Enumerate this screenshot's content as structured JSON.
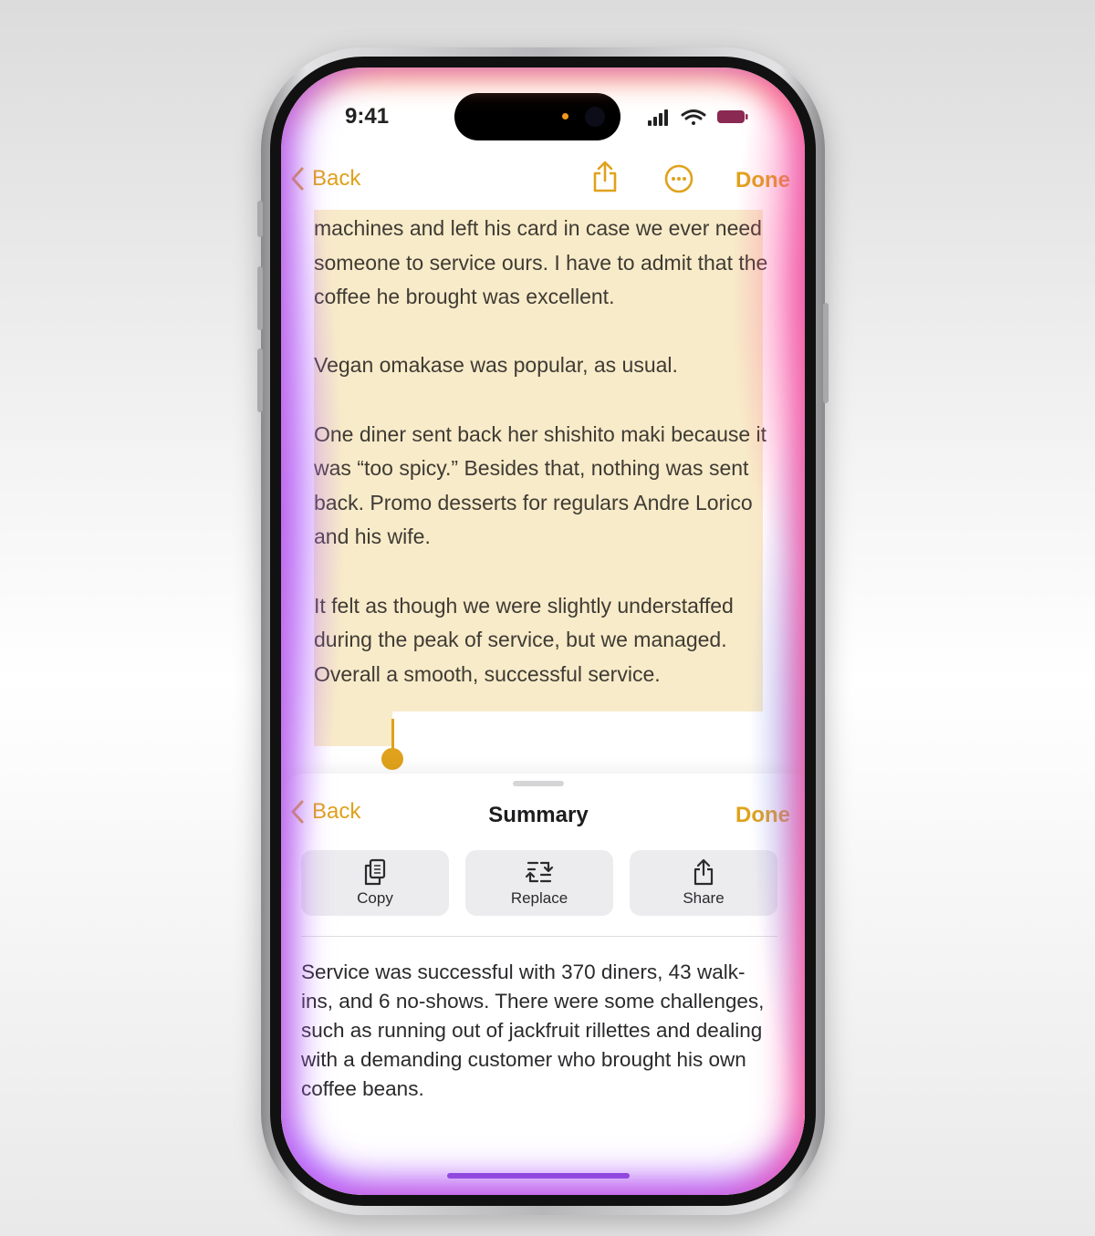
{
  "status_bar": {
    "time": "9:41"
  },
  "note_nav": {
    "back_label": "Back",
    "done_label": "Done",
    "share_icon": "share-icon",
    "more_icon": "ellipsis-circle-icon"
  },
  "note": {
    "paragraphs": [
      "machines and left his card in case we ever need someone to service ours. I have to admit that the coffee he brought was excellent.",
      "Vegan omakase was popular, as usual.",
      "One diner sent back her shishito maki because it was “too spicy.” Besides that, nothing was sent back. Promo desserts for regulars Andre Lorico and his wife.",
      "It felt as though we were slightly understaffed during the peak of service, but we managed. Overall a smooth, successful service."
    ]
  },
  "sheet": {
    "back_label": "Back",
    "title": "Summary",
    "done_label": "Done",
    "actions": [
      {
        "label": "Copy",
        "icon": "copy-icon"
      },
      {
        "label": "Replace",
        "icon": "replace-icon"
      },
      {
        "label": "Share",
        "icon": "share-icon"
      }
    ],
    "summary": "Service was successful with 370 diners, 43 walk-ins, and 6 no-shows. There were some challenges, such as running out of jackfruit rillettes and dealing with a demanding customer who brought his own coffee beans."
  },
  "colors": {
    "accent": "#e0a21c",
    "highlight": "#f8ebc9",
    "glow_purple": "#b25cff",
    "glow_pink": "#ff4aa0",
    "glow_orange": "#ffa050"
  }
}
